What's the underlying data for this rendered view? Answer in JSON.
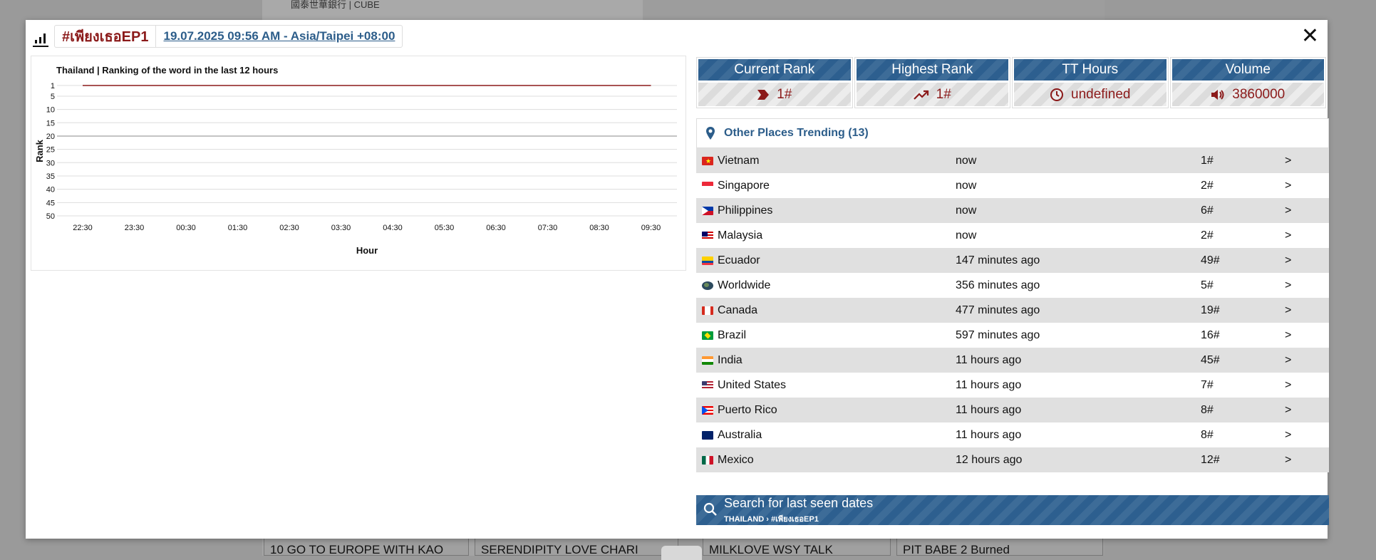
{
  "modal": {
    "hashtag": "#เพียงเธอEP1",
    "timestamp": "19.07.2025 09:56 AM - Asia/Taipei +08:00",
    "close_label": "✕"
  },
  "chart_data": {
    "type": "line",
    "title": "Thailand | Ranking of the word in the last 12 hours",
    "xlabel": "Hour",
    "ylabel": "Rank",
    "x": [
      "22:30",
      "23:30",
      "00:30",
      "01:30",
      "02:30",
      "03:30",
      "04:30",
      "05:30",
      "06:30",
      "07:30",
      "08:30",
      "09:30"
    ],
    "y_ticks": [
      1,
      5,
      10,
      15,
      20,
      25,
      30,
      35,
      40,
      45,
      50
    ],
    "ylim": [
      1,
      50
    ],
    "y_inverted": true,
    "grid": true,
    "series": [
      {
        "values": [
          1,
          1,
          1,
          1,
          1,
          1,
          1,
          1,
          1,
          1,
          1,
          1
        ],
        "color": "#8b1a1a"
      }
    ]
  },
  "stats": [
    {
      "label": "Current Rank",
      "value": "1#",
      "icon": "chevron-tag-icon"
    },
    {
      "label": "Highest Rank",
      "value": "1#",
      "icon": "trend-up-icon"
    },
    {
      "label": "TT Hours",
      "value": "undefined",
      "icon": "clock-icon"
    },
    {
      "label": "Volume",
      "value": "3860000",
      "icon": "speaker-icon"
    }
  ],
  "places": {
    "title": "Other Places Trending (13)",
    "rows": [
      {
        "country": "Vietnam",
        "time": "now",
        "rank": "1#",
        "arrow": ">",
        "flag": "vn"
      },
      {
        "country": "Singapore",
        "time": "now",
        "rank": "2#",
        "arrow": ">",
        "flag": "sg"
      },
      {
        "country": "Philippines",
        "time": "now",
        "rank": "6#",
        "arrow": ">",
        "flag": "ph"
      },
      {
        "country": "Malaysia",
        "time": "now",
        "rank": "2#",
        "arrow": ">",
        "flag": "my"
      },
      {
        "country": "Ecuador",
        "time": "147 minutes ago",
        "rank": "49#",
        "arrow": ">",
        "flag": "ec"
      },
      {
        "country": "Worldwide",
        "time": "356 minutes ago",
        "rank": "5#",
        "arrow": ">",
        "flag": "ww"
      },
      {
        "country": "Canada",
        "time": "477 minutes ago",
        "rank": "19#",
        "arrow": ">",
        "flag": "ca"
      },
      {
        "country": "Brazil",
        "time": "597 minutes ago",
        "rank": "16#",
        "arrow": ">",
        "flag": "br"
      },
      {
        "country": "India",
        "time": "11 hours ago",
        "rank": "45#",
        "arrow": ">",
        "flag": "in"
      },
      {
        "country": "United States",
        "time": "11 hours ago",
        "rank": "7#",
        "arrow": ">",
        "flag": "us"
      },
      {
        "country": "Puerto Rico",
        "time": "11 hours ago",
        "rank": "8#",
        "arrow": ">",
        "flag": "pr"
      },
      {
        "country": "Australia",
        "time": "11 hours ago",
        "rank": "8#",
        "arrow": ">",
        "flag": "au"
      },
      {
        "country": "Mexico",
        "time": "12 hours ago",
        "rank": "12#",
        "arrow": ">",
        "flag": "mx"
      }
    ]
  },
  "search": {
    "title": "Search for last seen dates",
    "subtitle": "THAILAND › #เพียงเธอEP1"
  },
  "background": {
    "banner_text": "國泰世華銀行 | CUBE",
    "bottom_cells": [
      "10 GO TO EUROPE WITH KAO",
      "SERENDIPITY LOVE CHARI",
      "MILKLOVE WSY TALK",
      "PIT BABE 2 Burned"
    ]
  }
}
